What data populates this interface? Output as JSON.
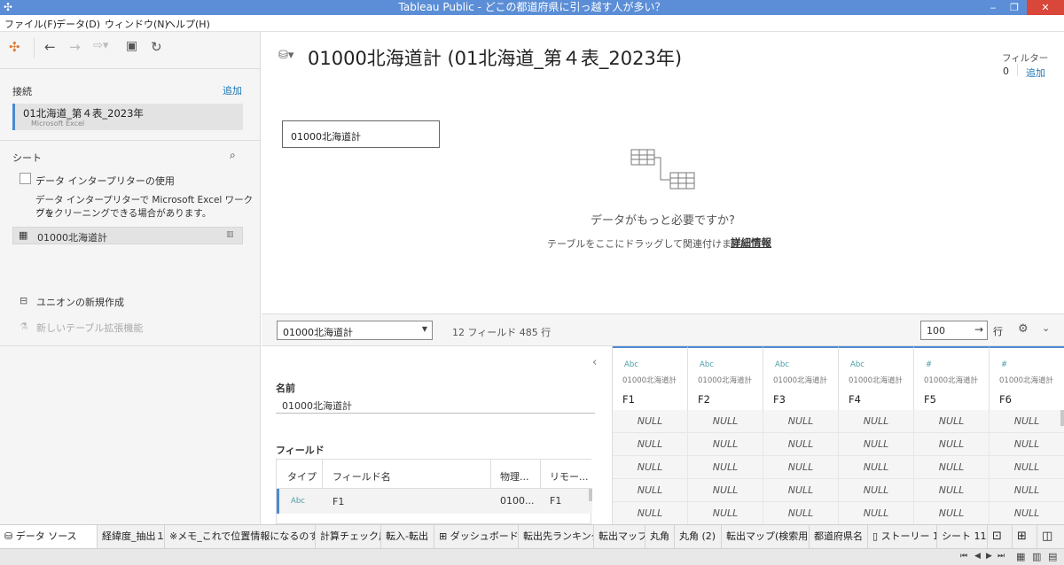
{
  "window": {
    "title": "Tableau Public - どこの都道府県に引っ越す人が多い？"
  },
  "menu": [
    "ファイル(F)",
    "データ(D)",
    "ウィンドウ(N)",
    "ヘルプ(H)"
  ],
  "connections": {
    "heading": "接続",
    "add": "追加",
    "name": "01北海道_第４表_2023年",
    "type": "Microsoft Excel"
  },
  "sheets": {
    "heading": "シート",
    "interpreter_label": "データ インタープリターの使用",
    "interpreter_note_1": "データ インタープリターで Microsoft Excel ワークブッ",
    "interpreter_note_2": "クをクリーニングできる場合があります。",
    "item": "01000北海道計",
    "union": "ユニオンの新規作成",
    "extension": "新しいテーブル拡張機能"
  },
  "canvas": {
    "title": "01000北海道計 (01北海道_第４表_2023年)",
    "filters_label": "フィルター",
    "filters_count": "0",
    "filters_add": "追加",
    "table_name": "01000北海道計",
    "more_data": "データがもっと必要ですか?",
    "drag_hint": "テーブルをここにドラッグして関連付けます。",
    "detail_link": "詳細情報"
  },
  "midbar": {
    "selected_table": "01000北海道計",
    "summary": "12 フィールド 485 行",
    "rows_value": "100",
    "rows_label": "行"
  },
  "meta": {
    "name_label": "名前",
    "name_value": "01000北海道計",
    "fields_label": "フィールド",
    "headers": [
      "タイプ",
      "フィールド名",
      "物理...",
      "リモー..."
    ],
    "row": {
      "type": "Abc",
      "name": "F1",
      "physical": "0100...",
      "remote": "F1"
    }
  },
  "grid": {
    "source": "01000北海道計",
    "columns": [
      {
        "type": "Abc",
        "name": "F1"
      },
      {
        "type": "Abc",
        "name": "F2"
      },
      {
        "type": "Abc",
        "name": "F3"
      },
      {
        "type": "Abc",
        "name": "F4"
      },
      {
        "type": "#",
        "name": "F5"
      },
      {
        "type": "#",
        "name": "F6"
      }
    ],
    "null_text": "NULL"
  },
  "tabs": [
    "データ ソース",
    "経緯度_抽出１",
    "※メモ_これで位置情報になるのすご…",
    "計算チェック用",
    "転入-転出",
    "ダッシュボード 1",
    "転出先ランキング",
    "転出マップ",
    "丸角",
    "丸角 (2)",
    "転出マップ(検索用)",
    "都道府県名",
    "ストーリー 1",
    "シート 11"
  ],
  "colors": {
    "accent": "#4b8bd0",
    "title_bar": "#5b8ed6",
    "close": "#d9463a",
    "type_text": "#4a9ea5"
  }
}
